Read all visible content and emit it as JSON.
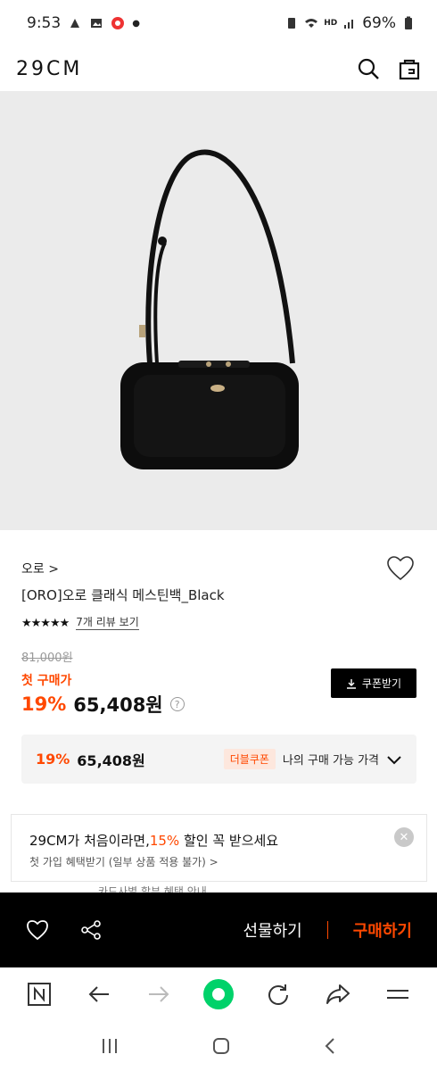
{
  "status_bar": {
    "time": "9:53",
    "battery": "69%",
    "network": "HD"
  },
  "header": {
    "logo": "29CM"
  },
  "product": {
    "brand": "오로 >",
    "name": "[ORO]오로 클래식 메스틴백_Black",
    "rating_stars": "★★★★★",
    "review_link": "7개 리뷰 보기",
    "original_price": "81,000원",
    "first_purchase_label": "첫 구매가",
    "discount": "19%",
    "price": "65,408원",
    "help_icon": "?"
  },
  "coupon_button": {
    "label": "쿠폰받기"
  },
  "price_box": {
    "discount": "19%",
    "price": "65,408원",
    "double_coupon": "더블쿠폰",
    "my_price": "나의 구매 가능 가격"
  },
  "banner": {
    "title_prefix": "29CM가 처음이라면,",
    "title_accent": "15%",
    "title_suffix": " 할인 꼭 받으세요",
    "subtitle": "첫 가입 혜택받기 (일부 상품 적용 불가) >"
  },
  "peek_text": "카드사별 할부 혜택 안내",
  "action_bar": {
    "gift": "선물하기",
    "buy": "구매하기"
  },
  "colors": {
    "accent": "#ff4800",
    "black": "#000000",
    "image_bg": "#ebebeb"
  },
  "icons": [
    "search-icon",
    "shopping-bag-icon",
    "heart-icon",
    "share-icon",
    "download-icon",
    "chevron-down-icon",
    "close-icon",
    "n-icon",
    "back-arrow-icon",
    "forward-arrow-icon",
    "home-dot-icon",
    "refresh-icon",
    "share-arrow-icon",
    "menu-icon"
  ]
}
